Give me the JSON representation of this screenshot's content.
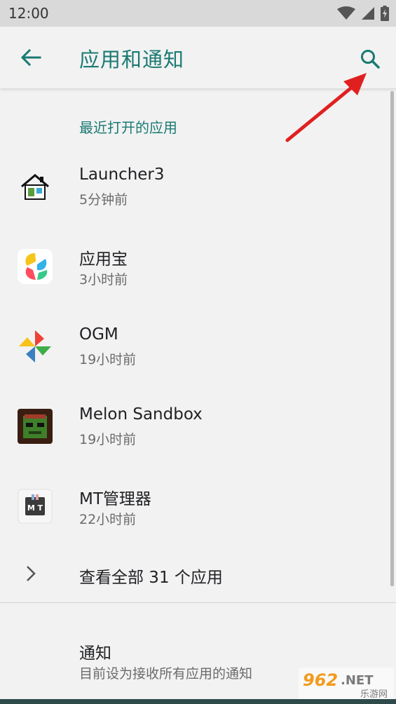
{
  "status_bar": {
    "time": "12:00"
  },
  "app_bar": {
    "title": "应用和通知",
    "back_icon": "arrow-back-icon",
    "search_icon": "search-icon"
  },
  "section": {
    "recent_header": "最近打开的应用"
  },
  "apps": [
    {
      "name": "Launcher3",
      "time": "5分钟前",
      "icon": "launcher3-icon"
    },
    {
      "name": "应用宝",
      "time": "3小时前",
      "icon": "yingyongbao-icon"
    },
    {
      "name": "OGM",
      "time": "19小时前",
      "icon": "ogm-icon"
    },
    {
      "name": "Melon Sandbox",
      "time": "19小时前",
      "icon": "melon-sandbox-icon"
    },
    {
      "name": "MT管理器",
      "time": "22小时前",
      "icon": "mt-manager-icon"
    }
  ],
  "see_all": {
    "label": "查看全部 31 个应用"
  },
  "notifications": {
    "title": "通知",
    "subtitle": "目前设为接收所有应用的通知"
  },
  "watermark": {
    "brand": "962.NET",
    "sub": "乐游网"
  },
  "colors": {
    "accent": "#1a7a72",
    "background": "#f2f2f2",
    "arrow": "#e02020"
  }
}
